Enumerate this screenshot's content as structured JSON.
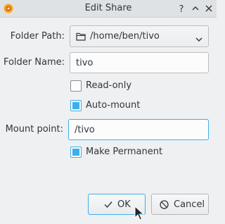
{
  "window": {
    "title": "Edit Share",
    "app_icon": "kde-settings-icon",
    "controls": [
      "help-icon",
      "minimize-icon",
      "close-icon"
    ]
  },
  "form": {
    "folder_path": {
      "label": "Folder Path:",
      "value": "/home/ben/tivo",
      "icon": "folder-icon"
    },
    "folder_name": {
      "label": "Folder Name:",
      "value": "tivo"
    },
    "read_only": {
      "label": "Read-only",
      "checked": false
    },
    "auto_mount": {
      "label": "Auto-mount",
      "checked": true
    },
    "mount_point": {
      "label": "Mount point:",
      "value": "/tivo"
    },
    "make_permanent": {
      "label": "Make Permanent",
      "checked": true
    }
  },
  "buttons": {
    "ok": {
      "label": "OK",
      "icon": "checkmark-icon"
    },
    "cancel": {
      "label": "Cancel",
      "icon": "cancel-icon"
    }
  },
  "colors": {
    "accent": "#3daee9",
    "background": "#eff0f1"
  }
}
